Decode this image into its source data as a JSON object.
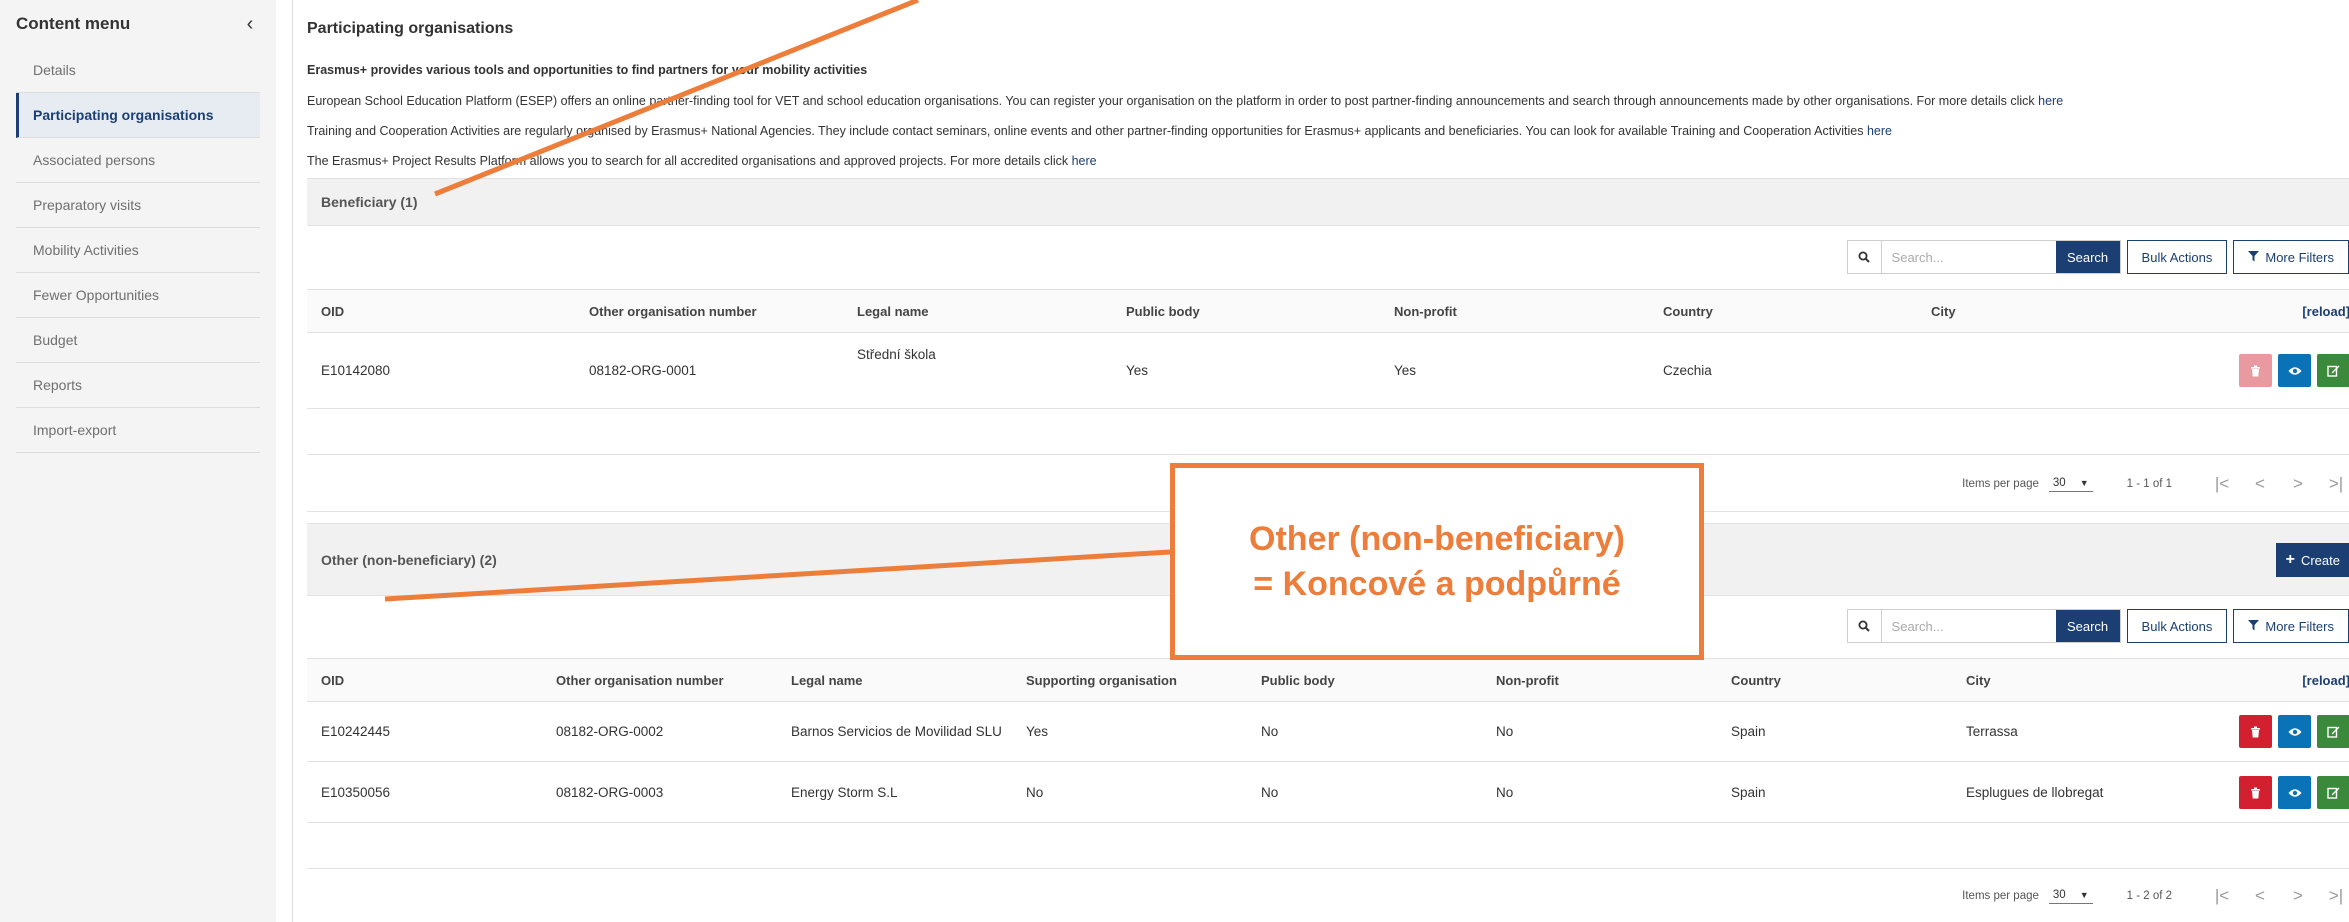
{
  "sidebar": {
    "title": "Content menu",
    "items": [
      {
        "label": "Details"
      },
      {
        "label": "Participating organisations"
      },
      {
        "label": "Associated persons"
      },
      {
        "label": "Preparatory visits"
      },
      {
        "label": "Mobility Activities"
      },
      {
        "label": "Fewer Opportunities"
      },
      {
        "label": "Budget"
      },
      {
        "label": "Reports"
      },
      {
        "label": "Import-export"
      }
    ]
  },
  "page": {
    "title": "Participating organisations",
    "intro_heading": "Erasmus+ provides various tools and opportunities to find partners for your mobility activities",
    "lines": [
      {
        "text": "European School Education Platform (ESEP) offers an online partner-finding tool for VET and school education organisations. You can register your organisation on the platform in order to post partner-finding announcements and search through announcements made by other organisations. For more details click ",
        "link": "here"
      },
      {
        "text": "Training and Cooperation Activities are regularly organised by Erasmus+ National Agencies. They include contact seminars, online events and other partner-finding opportunities for Erasmus+ applicants and beneficiaries. You can look for available Training and Cooperation Activities ",
        "link": "here"
      },
      {
        "text": "The Erasmus+ Project Results Platform allows you to search for all accredited organisations and approved projects. For more details click ",
        "link": "here"
      }
    ]
  },
  "toolbar": {
    "search_placeholder": "Search...",
    "search_label": "Search",
    "bulk_label": "Bulk Actions",
    "filters_label": "More Filters",
    "create_label": "Create",
    "reload_label": "[reload]"
  },
  "beneficiary": {
    "title": "Beneficiary (1)",
    "columns": [
      "OID",
      "Other organisation number",
      "Legal name",
      "Public body",
      "Non-profit",
      "Country",
      "City"
    ],
    "rows": [
      {
        "oid": "E10142080",
        "number": "08182-ORG-0001",
        "legal_name": "Střední škola",
        "public_body": "Yes",
        "non_profit": "Yes",
        "country": "Czechia",
        "city": ""
      }
    ],
    "pager": {
      "label": "Items per page",
      "per_page": "30",
      "range": "1 - 1 of 1"
    }
  },
  "other": {
    "title": "Other (non-beneficiary) (2)",
    "columns": [
      "OID",
      "Other organisation number",
      "Legal name",
      "Supporting organisation",
      "Public body",
      "Non-profit",
      "Country",
      "City"
    ],
    "rows": [
      {
        "oid": "E10242445",
        "number": "08182-ORG-0002",
        "legal_name": "Barnos Servicios de Movilidad SLU",
        "supporting": "Yes",
        "public_body": "No",
        "non_profit": "No",
        "country": "Spain",
        "city": "Terrassa"
      },
      {
        "oid": "E10350056",
        "number": "08182-ORG-0003",
        "legal_name": "Energy Storm S.L",
        "supporting": "No",
        "public_body": "No",
        "non_profit": "No",
        "country": "Spain",
        "city": "Esplugues de llobregat"
      }
    ],
    "pager": {
      "label": "Items per page",
      "per_page": "30",
      "range": "1 - 2 of 2"
    }
  },
  "annotation": {
    "line1": "Other (non-beneficiary)",
    "line2": "= Koncové a podpůrné",
    "color": "#ed7d3a"
  },
  "colors": {
    "primary": "#1b3f73",
    "delete": "#d32030",
    "view": "#0a73b7",
    "edit": "#3b8a3b"
  }
}
